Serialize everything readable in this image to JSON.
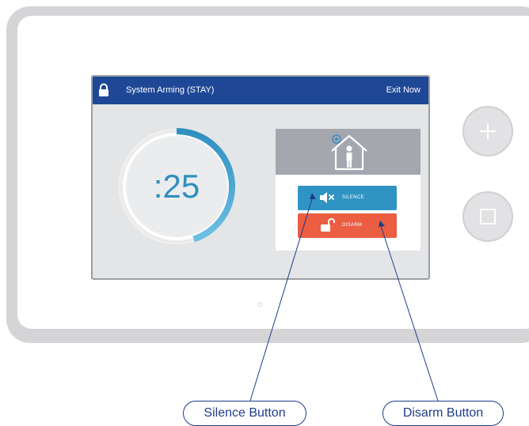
{
  "screen": {
    "title": "System Arming (STAY)",
    "exit_label": "Exit Now",
    "countdown": ":25",
    "countdown_progress": 0.45
  },
  "actions": {
    "silence_label": "SILENCE",
    "disarm_label": "DISARM"
  },
  "callouts": {
    "silence": "Silence Button",
    "disarm": "Disarm Button"
  },
  "icons": {
    "lock": "lock-icon",
    "house": "house-person-icon",
    "speaker": "speaker-mute-icon",
    "unlock": "unlock-icon",
    "plus": "plus-icon",
    "square": "square-icon"
  },
  "colors": {
    "titlebar": "#1e4896",
    "silence": "#2f94c4",
    "disarm": "#eb5e42",
    "accent": "#2d8fbf",
    "callout": "#1e3c8c"
  }
}
